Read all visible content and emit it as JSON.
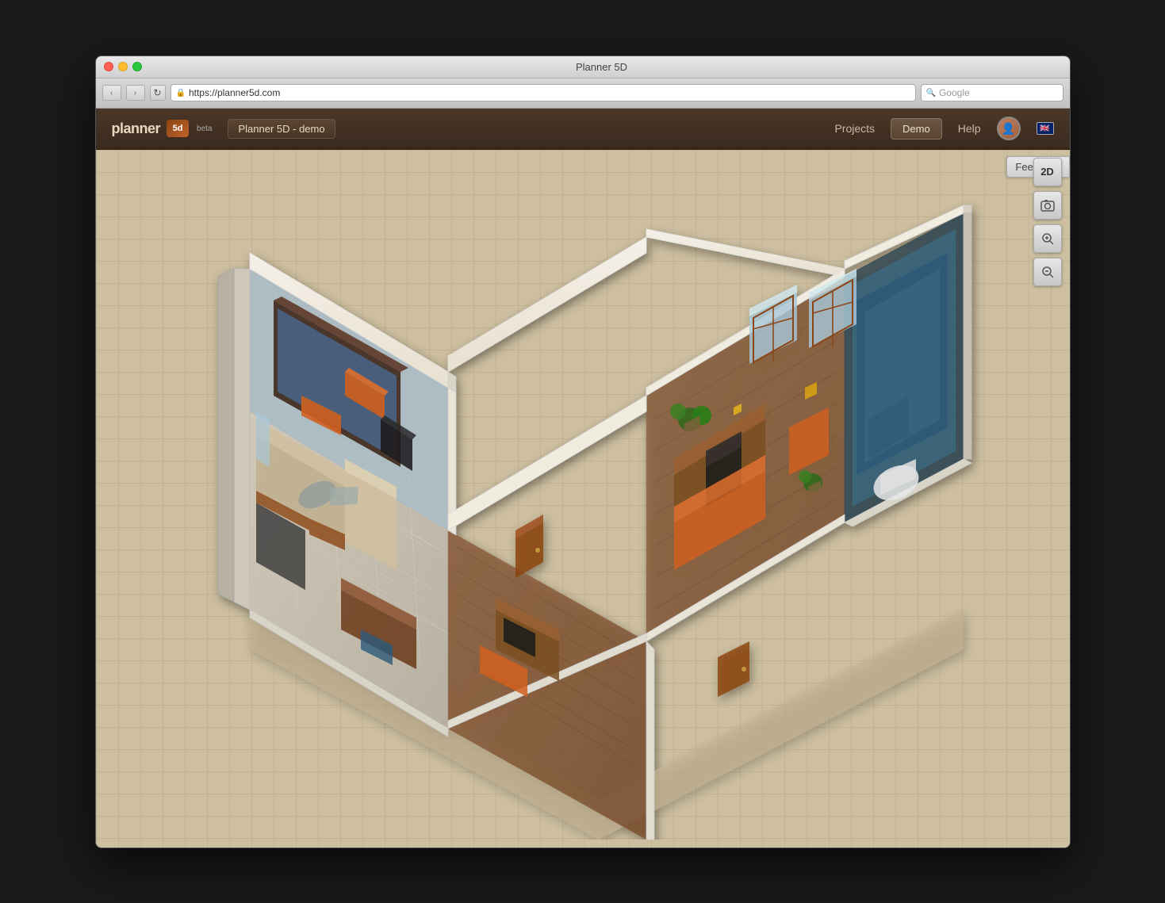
{
  "window": {
    "title": "Planner 5D",
    "url": "https://planner5d.com"
  },
  "browser": {
    "back_label": "‹",
    "forward_label": "›",
    "reload_label": "↻",
    "search_placeholder": "Google"
  },
  "header": {
    "logo_text": "planner",
    "logo_box": "5d",
    "beta_label": "beta",
    "project_name": "Planner 5D - demo",
    "nav": {
      "projects_label": "Projects",
      "demo_label": "Demo",
      "help_label": "Help"
    }
  },
  "toolbar": {
    "feedback_label": "Feedback",
    "view_2d_label": "2D",
    "screenshot_label": "📷",
    "zoom_in_label": "⊕",
    "zoom_out_label": "⊖"
  }
}
